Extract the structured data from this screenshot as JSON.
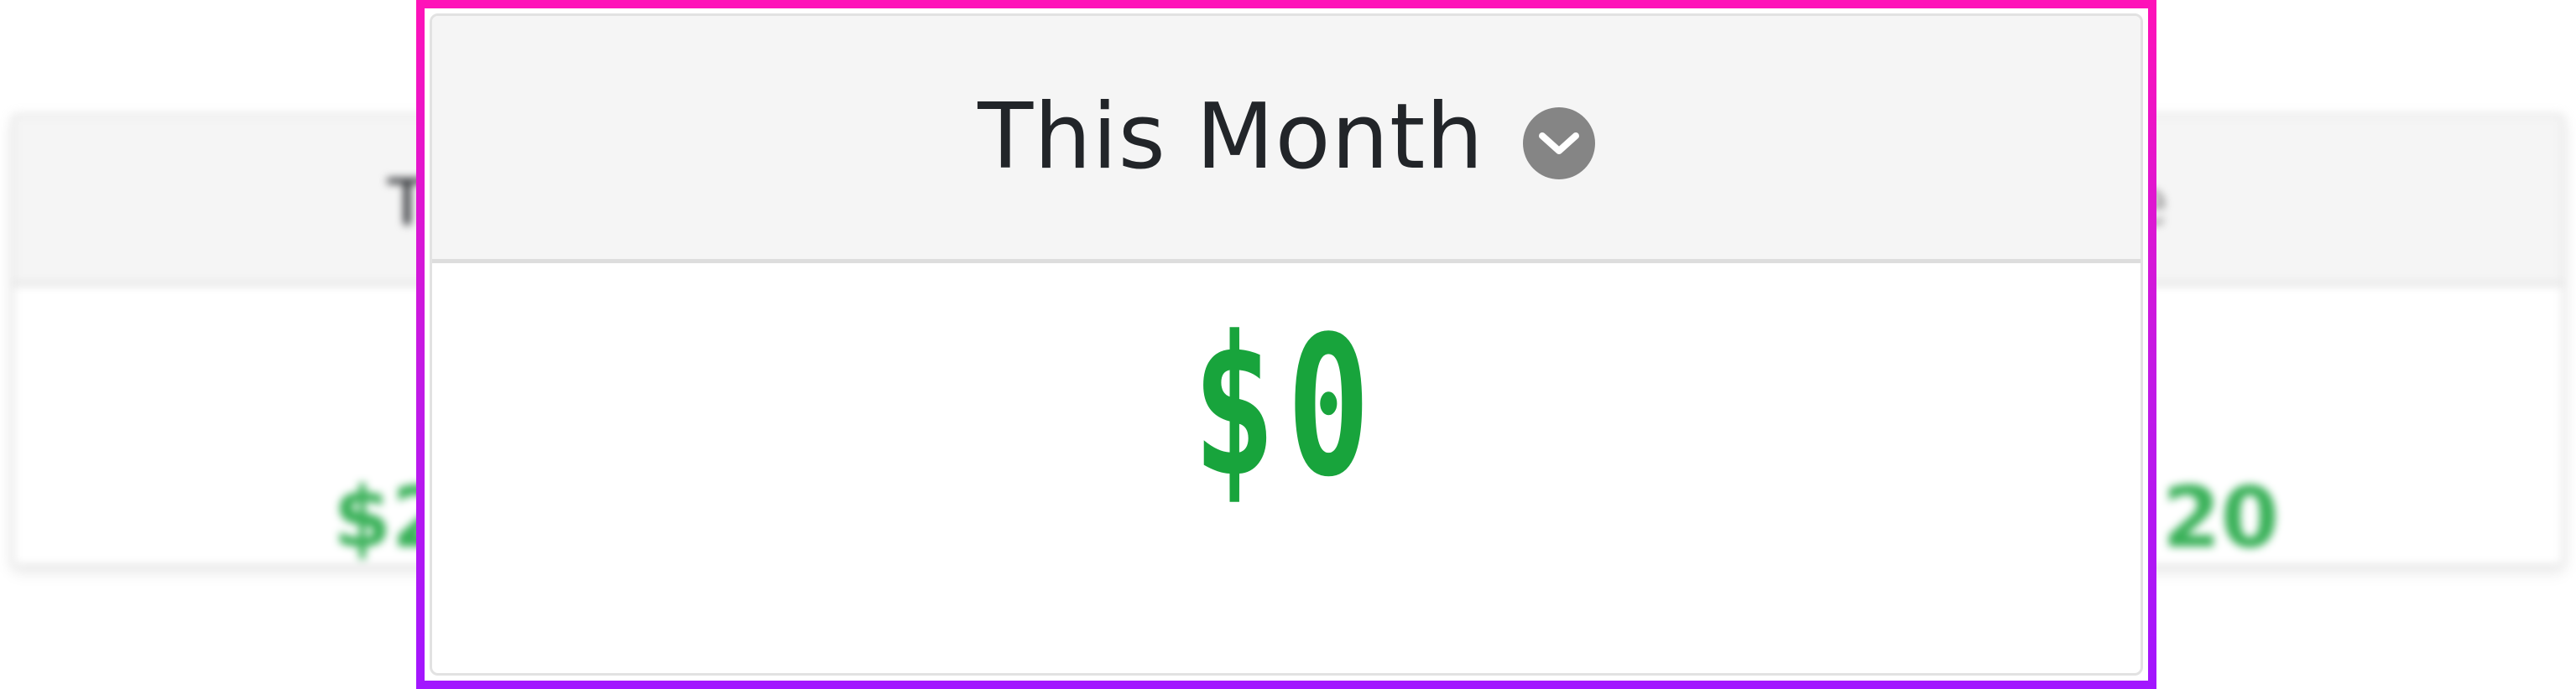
{
  "background_card": {
    "header_left": "T",
    "header_right": "e",
    "value_left": "$2",
    "value_right": "20"
  },
  "popup": {
    "title": "This Month",
    "dropdown_icon": "chevron-down-circle-icon",
    "amount": "$0"
  },
  "colors": {
    "amount": "#18a43c",
    "header_bg": "#f5f5f5",
    "title": "#222529",
    "icon_bg": "#858585",
    "highlight_top": "#ff12b8",
    "highlight_bottom": "#a216ff"
  }
}
